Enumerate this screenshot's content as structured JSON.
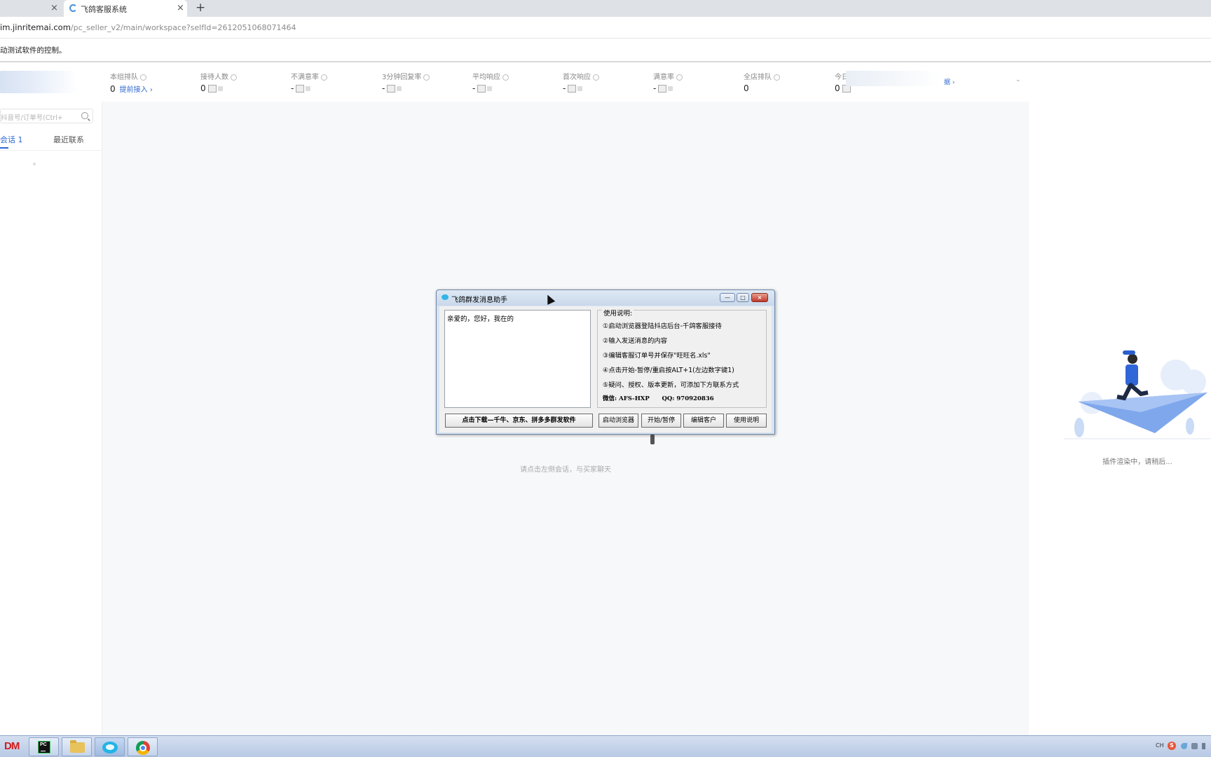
{
  "browser": {
    "tabs": [
      {
        "label": "",
        "close": "×"
      },
      {
        "label": "飞鸽客服系统",
        "close": "×"
      }
    ],
    "new_tab": "+",
    "address": {
      "host": "im.jinritemai.com",
      "path": "/pc_seller_v2/main/workspace?selfId=2612051068071464"
    },
    "infobar_text": "动测试软件的控制。"
  },
  "sidebar": {
    "search_placeholder": "抖音号/订单号(Ctrl+",
    "tabs": [
      {
        "label": "会话 1"
      },
      {
        "label": "最近联系"
      }
    ]
  },
  "stats": [
    {
      "label": "本组排队",
      "value": "0",
      "link": "提前接入 ›"
    },
    {
      "label": "接待人数",
      "value": "0"
    },
    {
      "label": "不满意率",
      "value": "-"
    },
    {
      "label": "3分钟回复率",
      "value": "-"
    },
    {
      "label": "平均响应",
      "value": "-"
    },
    {
      "label": "首次响应",
      "value": "-"
    },
    {
      "label": "满意率",
      "value": "-"
    },
    {
      "label": "全店排队",
      "value": "0"
    },
    {
      "label": "今日",
      "value": "0"
    }
  ],
  "stats_extra": {
    "today_link": "据 ›",
    "expand": "⌄"
  },
  "main": {
    "hint": "请点击左侧会话，与买家聊天"
  },
  "right_panel": {
    "hint": "插件渲染中，请稍后..."
  },
  "dialog": {
    "title": "飞鸽群发消息助手",
    "window_buttons": {
      "minimize": "—",
      "maximize": "□",
      "close": "×"
    },
    "message_text": "亲爱的，您好，我在的",
    "instructions_title": "使用说明:",
    "instructions": [
      "①启动浏览器登陆抖店后台-千鸽客服接待",
      "②输入发送消息的内容",
      "③编辑客服订单号并保存\"旺旺名.xls\"",
      "④点击开始-暂停/重启按ALT+1(左边数字键1)",
      "⑤疑问、授权、版本更新，可添加下方联系方式"
    ],
    "contact": "微信: AFS-HXP      QQ: 970920836",
    "buttons": {
      "download": "点击下载—千牛、京东、拼多多群发软件",
      "start_browser": "启动浏览器",
      "start_pause": "开始/暂停",
      "edit_customers": "编辑客户",
      "usage": "使用说明"
    }
  },
  "taskbar": {
    "dm_label": "DM",
    "apps": [
      {
        "icon": "pycharm-icon",
        "label": "PC"
      },
      {
        "icon": "folder-icon"
      },
      {
        "icon": "chat-app-icon"
      },
      {
        "icon": "chrome-icon"
      }
    ],
    "tray": {
      "lang": "CH",
      "ime": "S"
    }
  },
  "colors": {
    "accent": "#2e67d1",
    "dialog_frame": "#d9e4f1",
    "taskbar": "#b8c9e4",
    "close_red": "#c0392b"
  }
}
